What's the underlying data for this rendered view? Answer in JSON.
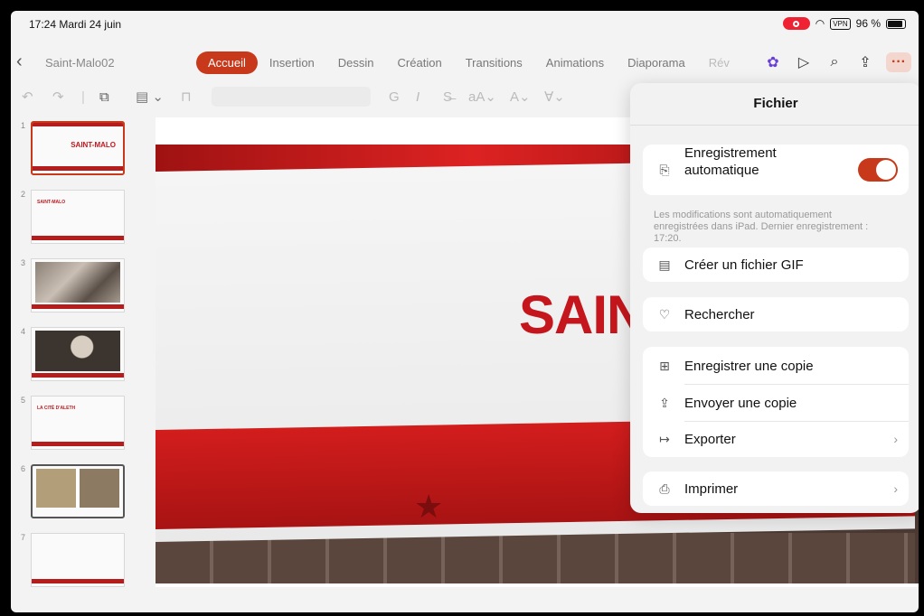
{
  "status": {
    "time": "17:24",
    "date": "Mardi 24 juin",
    "vpn": "VPN",
    "battery": "96 %"
  },
  "document": {
    "title": "Saint-Malo02"
  },
  "tabs": [
    {
      "label": "Accueil"
    },
    {
      "label": "Insertion"
    },
    {
      "label": "Dessin"
    },
    {
      "label": "Création"
    },
    {
      "label": "Transitions"
    },
    {
      "label": "Animations"
    },
    {
      "label": "Diaporama"
    },
    {
      "label": "Rév"
    }
  ],
  "toolbar_icons": [
    "undo-icon",
    "redo-icon",
    "new-slide-icon",
    "layout-icon",
    "format-painter-icon",
    "bold-icon",
    "italic-icon",
    "strikethrough-icon",
    "font-size-icon",
    "font-color-icon",
    "highlight-icon"
  ],
  "thumbnails": [
    {
      "num": "1",
      "caption": "SAINT-MALO"
    },
    {
      "num": "2",
      "caption": "SAINT-MALO"
    },
    {
      "num": "3",
      "caption": ""
    },
    {
      "num": "4",
      "caption": ""
    },
    {
      "num": "5",
      "caption": "LA CITÉ D'ALETH"
    },
    {
      "num": "6",
      "caption": ""
    },
    {
      "num": "7",
      "caption": ""
    }
  ],
  "slide": {
    "title_visible": "SAIN"
  },
  "menu": {
    "title": "Fichier",
    "autosave_label_line1": "Enregistrement",
    "autosave_label_line2": "automatique",
    "autosave_note": "Les modifications sont automatiquement enregistrées dans iPad. Dernier enregistrement : 17:20.",
    "gif_label": "Créer un fichier GIF",
    "search_label": "Rechercher",
    "save_copy_label": "Enregistrer une copie",
    "send_copy_label": "Envoyer une copie",
    "export_label": "Exporter",
    "print_label": "Imprimer"
  },
  "colors": {
    "accent": "#c8381a",
    "slide_red": "#c4161c"
  }
}
